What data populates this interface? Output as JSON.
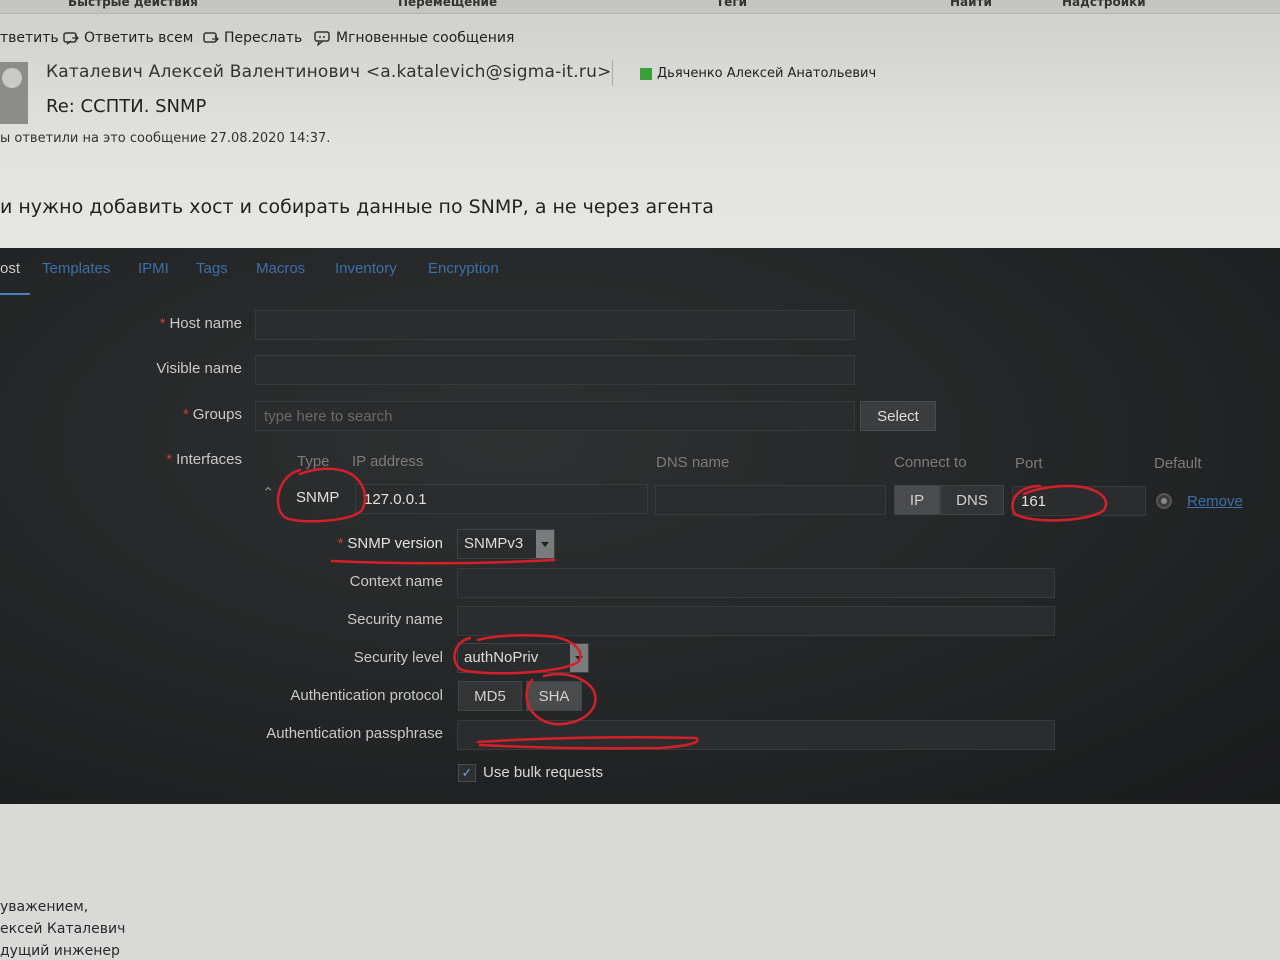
{
  "outlook": {
    "topbar": [
      "Быстрые действия",
      "Перемещение",
      "Теги",
      "Найти",
      "Надстройки"
    ],
    "actions": {
      "reply": "тветить",
      "reply_all": "Ответить всем",
      "forward": "Переслать",
      "im": "Мгновенные сообщения"
    },
    "sender": "Каталевич Алексей Валентинович <a.katalevich@sigma-it.ru>",
    "recipient": "Дьяченко Алексей Анатольевич",
    "subject": "Re: ССПТИ. SNMP",
    "replied_info": "ы ответили на это сообщение 27.08.2020 14:37.",
    "body_line": "и нужно добавить хост и собирать данные по SNMP, а не через агента",
    "signature": [
      "уважением,",
      "ексей Каталевич",
      "дущий инженер"
    ]
  },
  "zabbix": {
    "tabs": [
      "ost",
      "Templates",
      "IPMI",
      "Tags",
      "Macros",
      "Inventory",
      "Encryption"
    ],
    "host_name_label": "Host name",
    "visible_name_label": "Visible name",
    "groups_label": "Groups",
    "groups_placeholder": "type here to search",
    "select_button": "Select",
    "interfaces_label": "Interfaces",
    "columns": {
      "type": "Type",
      "ip": "IP address",
      "dns": "DNS name",
      "connect": "Connect to",
      "port": "Port",
      "default": "Default"
    },
    "interface": {
      "type": "SNMP",
      "ip": "127.0.0.1",
      "dns": "",
      "connect_ip": "IP",
      "connect_dns": "DNS",
      "port": "161",
      "remove": "Remove"
    },
    "snmp_version_label": "SNMP version",
    "snmp_version": "SNMPv3",
    "context_name_label": "Context name",
    "security_name_label": "Security name",
    "security_level_label": "Security level",
    "security_level": "authNoPriv",
    "auth_protocol_label": "Authentication protocol",
    "auth_md5": "MD5",
    "auth_sha": "SHA",
    "auth_pass_label": "Authentication passphrase",
    "bulk_label": "Use bulk requests",
    "bulk_checked": true
  },
  "colors": {
    "annotation": "#d4202a",
    "link": "#3d6fa8",
    "panel_bg": "#252728"
  }
}
